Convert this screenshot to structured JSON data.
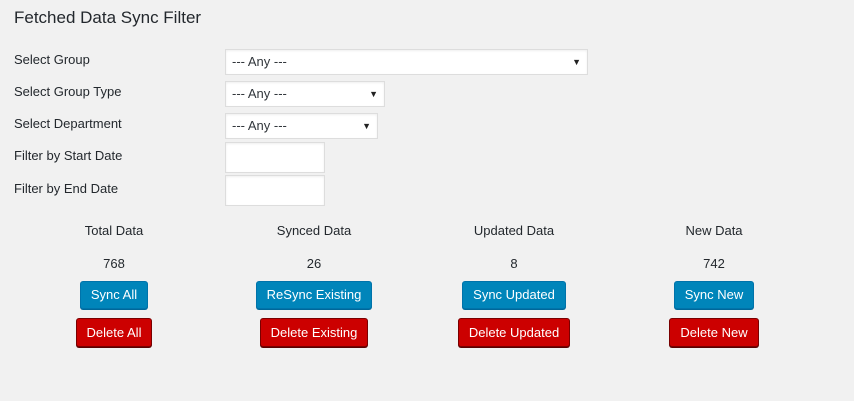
{
  "page": {
    "title": "Fetched Data Sync Filter"
  },
  "filters": {
    "group_label": "Select Group",
    "group_value": "--- Any ---",
    "group_type_label": "Select Group Type",
    "group_type_value": "--- Any ---",
    "department_label": "Select Department",
    "department_value": "--- Any ---",
    "start_date_label": "Filter by Start Date",
    "start_date_value": "",
    "end_date_label": "Filter by End Date",
    "end_date_value": "",
    "arrow_glyph": "▼"
  },
  "stats": [
    {
      "title": "Total Data",
      "value": "768",
      "sync_label": "Sync All",
      "delete_label": "Delete All"
    },
    {
      "title": "Synced Data",
      "value": "26",
      "sync_label": "ReSync Existing",
      "delete_label": "Delete Existing"
    },
    {
      "title": "Updated Data",
      "value": "8",
      "sync_label": "Sync Updated",
      "delete_label": "Delete Updated"
    },
    {
      "title": "New Data",
      "value": "742",
      "sync_label": "Sync New",
      "delete_label": "Delete New"
    }
  ],
  "colors": {
    "background": "#f1f1f1",
    "primary_button": "#0085ba",
    "danger_button": "#cc0000"
  }
}
